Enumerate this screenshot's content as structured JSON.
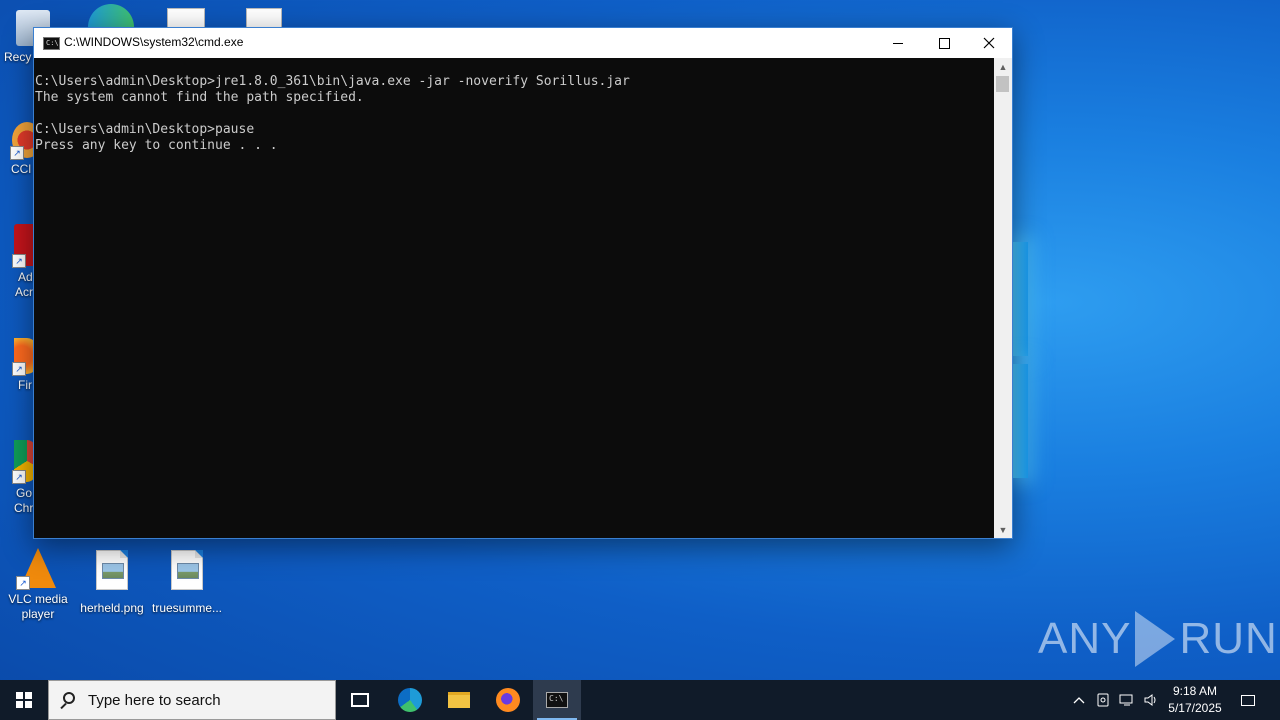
{
  "desktop": {
    "top_partial_labels": {
      "recycle": "Recy",
      "ccleaner": "CCl",
      "adobe_1": "Ad",
      "adobe_2": "Acr",
      "firefox": "Fir",
      "chrome_1": "Go",
      "chrome_2": "Chr"
    },
    "icons": [
      {
        "label_line1": "VLC media",
        "label_line2": "player"
      },
      {
        "label_line1": "herheld.png",
        "label_line2": ""
      },
      {
        "label_line1": "truesumme...",
        "label_line2": ""
      }
    ]
  },
  "window": {
    "title": "C:\\WINDOWS\\system32\\cmd.exe",
    "console_lines": [
      "C:\\Users\\admin\\Desktop>jre1.8.0_361\\bin\\java.exe -jar -noverify Sorillus.jar",
      "The system cannot find the path specified.",
      "",
      "C:\\Users\\admin\\Desktop>pause",
      "Press any key to continue . . ."
    ]
  },
  "watermark": {
    "left": "ANY",
    "right": "RUN"
  },
  "taskbar": {
    "search_placeholder": "Type here to search",
    "time": "9:18 AM",
    "date": "5/17/2025"
  },
  "colors": {
    "console_bg": "#0c0c0c",
    "console_fg": "#cccccc",
    "taskbar_bg": "#101b29",
    "desktop_accent": "#1a7fe0"
  }
}
